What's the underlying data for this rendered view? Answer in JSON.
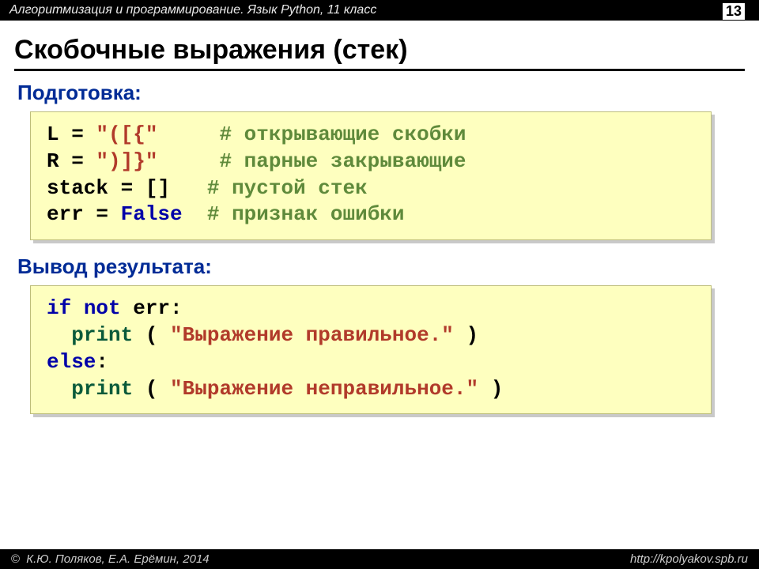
{
  "header": {
    "course": "Алгоритмизация и программирование. Язык Python, 11 класс",
    "page_number": "13"
  },
  "title": "Скобочные выражения (стек)",
  "section1": {
    "label": "Подготовка:",
    "code": {
      "l1a": "L",
      "l1eq": " = ",
      "l1b": "\"([{\"",
      "l1pad": "     ",
      "l1c": "# открывающие скобки",
      "l2a": "R",
      "l2eq": " = ",
      "l2b": "\")]}\"",
      "l2pad": "     ",
      "l2c": "# парные закрывающие",
      "l3a": "stack",
      "l3eq": " = ",
      "l3b": "[]",
      "l3pad": "   ",
      "l3c": "# пустой стек",
      "l4a": "err",
      "l4eq": " = ",
      "l4b": "False",
      "l4pad": "  ",
      "l4c": "# признак ошибки"
    }
  },
  "section2": {
    "label": "Вывод результата:",
    "code": {
      "l1a": "if",
      "l1b": " not",
      "l1c": " err:",
      "l2a": "  ",
      "l2b": "print",
      "l2c": " ( ",
      "l2d": "\"Выражение правильное.\"",
      "l2e": " )",
      "l3a": "else",
      "l3b": ":",
      "l4a": "  ",
      "l4b": "print",
      "l4c": " ( ",
      "l4d": "\"Выражение неправильное.\"",
      "l4e": " )"
    }
  },
  "footer": {
    "copyright": " К.Ю. Поляков, Е.А. Ерёмин, 2014",
    "url": "http://kpolyakov.spb.ru"
  }
}
